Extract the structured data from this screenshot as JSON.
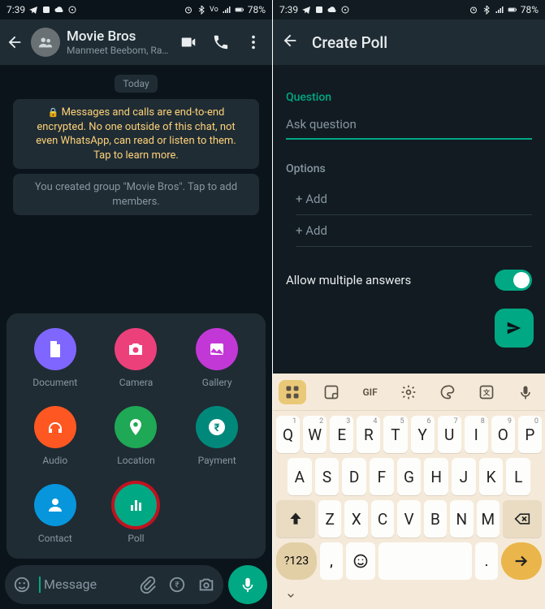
{
  "status": {
    "time": "7:39",
    "battery": "78%"
  },
  "left": {
    "header": {
      "title": "Movie Bros",
      "subtitle": "Manmeet Beebom, Ramji..."
    },
    "today": "Today",
    "e2e": "Messages and calls are end-to-end encrypted. No one outside of this chat, not even WhatsApp, can read or listen to them. Tap to learn more.",
    "created": "You created group \"Movie Bros\". Tap to add members.",
    "attachments": {
      "document": "Document",
      "camera": "Camera",
      "gallery": "Gallery",
      "audio": "Audio",
      "location": "Location",
      "payment": "Payment",
      "contact": "Contact",
      "poll": "Poll"
    },
    "compose_placeholder": "Message"
  },
  "right": {
    "title": "Create Poll",
    "question_label": "Question",
    "question_placeholder": "Ask question",
    "options_label": "Options",
    "add": "+ Add",
    "allow": "Allow multiple answers"
  },
  "keyboard": {
    "gif": "GIF",
    "row1": [
      "Q",
      "W",
      "E",
      "R",
      "T",
      "Y",
      "U",
      "I",
      "O",
      "P"
    ],
    "sup1": [
      "1",
      "2",
      "3",
      "4",
      "5",
      "6",
      "7",
      "8",
      "9",
      "0"
    ],
    "row2": [
      "A",
      "S",
      "D",
      "F",
      "G",
      "H",
      "J",
      "K",
      "L"
    ],
    "row3": [
      "Z",
      "X",
      "C",
      "V",
      "B",
      "N",
      "M"
    ],
    "sym": "?123",
    "comma": ",",
    "dot": "."
  }
}
